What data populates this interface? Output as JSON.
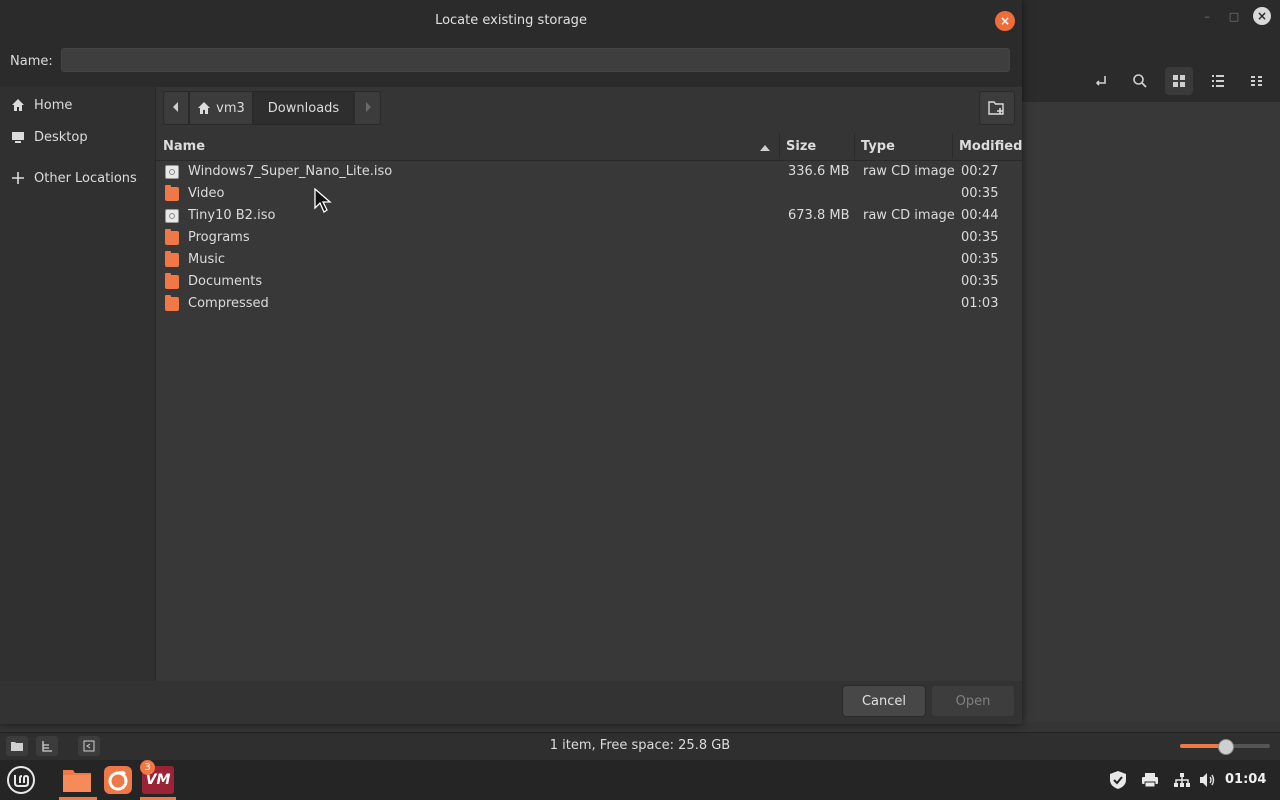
{
  "dialog": {
    "title": "Locate existing storage",
    "name_label": "Name:",
    "name_value": "",
    "cancel_label": "Cancel",
    "open_label": "Open"
  },
  "sidebar": {
    "items": [
      {
        "label": "Home",
        "icon": "home-icon"
      },
      {
        "label": "Desktop",
        "icon": "desktop-icon"
      },
      {
        "label": "Other Locations",
        "icon": "plus-icon"
      }
    ]
  },
  "pathbar": {
    "segments": [
      "vm3",
      "Downloads"
    ]
  },
  "columns": {
    "name": "Name",
    "size": "Size",
    "type": "Type",
    "modified": "Modified"
  },
  "files": [
    {
      "name": "Windows7_Super_Nano_Lite.iso",
      "size": "336.6 MB",
      "type": "raw CD image",
      "modified": "00:27",
      "kind": "iso"
    },
    {
      "name": "Video",
      "size": "",
      "type": "",
      "modified": "00:35",
      "kind": "folder"
    },
    {
      "name": "Tiny10 B2.iso",
      "size": "673.8 MB",
      "type": "raw CD image",
      "modified": "00:44",
      "kind": "iso"
    },
    {
      "name": "Programs",
      "size": "",
      "type": "",
      "modified": "00:35",
      "kind": "folder"
    },
    {
      "name": "Music",
      "size": "",
      "type": "",
      "modified": "00:35",
      "kind": "folder"
    },
    {
      "name": "Documents",
      "size": "",
      "type": "",
      "modified": "00:35",
      "kind": "folder"
    },
    {
      "name": "Compressed",
      "size": "",
      "type": "",
      "modified": "01:03",
      "kind": "folder"
    }
  ],
  "statusbar": {
    "text": "1 item, Free space: 25.8 GB",
    "zoom_fraction": 0.5
  },
  "taskbar": {
    "badge": "3",
    "vm_label": "VM",
    "clock": "01:04"
  },
  "colors": {
    "accent": "#f07746"
  }
}
